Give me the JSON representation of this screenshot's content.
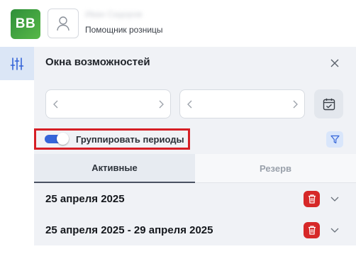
{
  "header": {
    "logo_text": "BB",
    "user_name": "Иван Сидоров",
    "user_role": "Помощник розницы"
  },
  "rail": {
    "icon": "sliders-icon"
  },
  "panel": {
    "title": "Окна возможностей",
    "close_icon": "close-icon",
    "date_from": {
      "value": "",
      "prev_icon": "chevron-left-icon",
      "next_icon": "chevron-right-icon"
    },
    "date_to": {
      "value": "",
      "prev_icon": "chevron-left-icon",
      "next_icon": "chevron-right-icon"
    },
    "calendar_icon": "calendar-check-icon",
    "group_periods": {
      "label": "Группировать периоды",
      "enabled": true
    },
    "filter_icon": "filter-icon",
    "tabs": [
      {
        "label": "Активные",
        "active": true
      },
      {
        "label": "Резерв",
        "active": false
      }
    ],
    "periods": [
      {
        "label": "25 апреля 2025"
      },
      {
        "label": "25 апреля 2025 - 29 апреля 2025"
      }
    ]
  },
  "colors": {
    "accent_blue": "#3565d9",
    "delete_red": "#d62828",
    "highlight_red": "#d61f26",
    "logo_green": "#3f9e3f"
  }
}
